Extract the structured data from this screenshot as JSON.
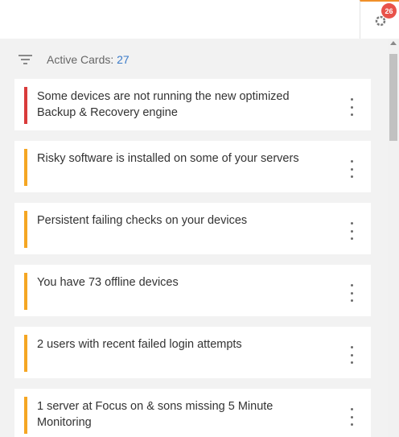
{
  "topbar": {
    "notification_count": "26",
    "notification_icon": "gear-icon"
  },
  "filter": {
    "icon": "filter-icon",
    "label": "Active Cards:",
    "count": "27"
  },
  "cards": [
    {
      "title": "Some devices are not running the new optimized Backup & Recovery engine",
      "severity_color": "#d93b3b"
    },
    {
      "title": "Risky software is installed on some of your servers",
      "severity_color": "#f5a623"
    },
    {
      "title": "Persistent failing checks on your devices",
      "severity_color": "#f5a623"
    },
    {
      "title": "You have 73 offline devices",
      "severity_color": "#f5a623"
    },
    {
      "title": "2 users with recent failed login attempts",
      "severity_color": "#f5a623"
    },
    {
      "title": "1 server at Focus on & sons missing 5 Minute Monitoring",
      "severity_color": "#f5a623"
    }
  ],
  "colors": {
    "accent": "#f0902a",
    "badge": "#e8524a",
    "count_link": "#3a7ac8"
  }
}
